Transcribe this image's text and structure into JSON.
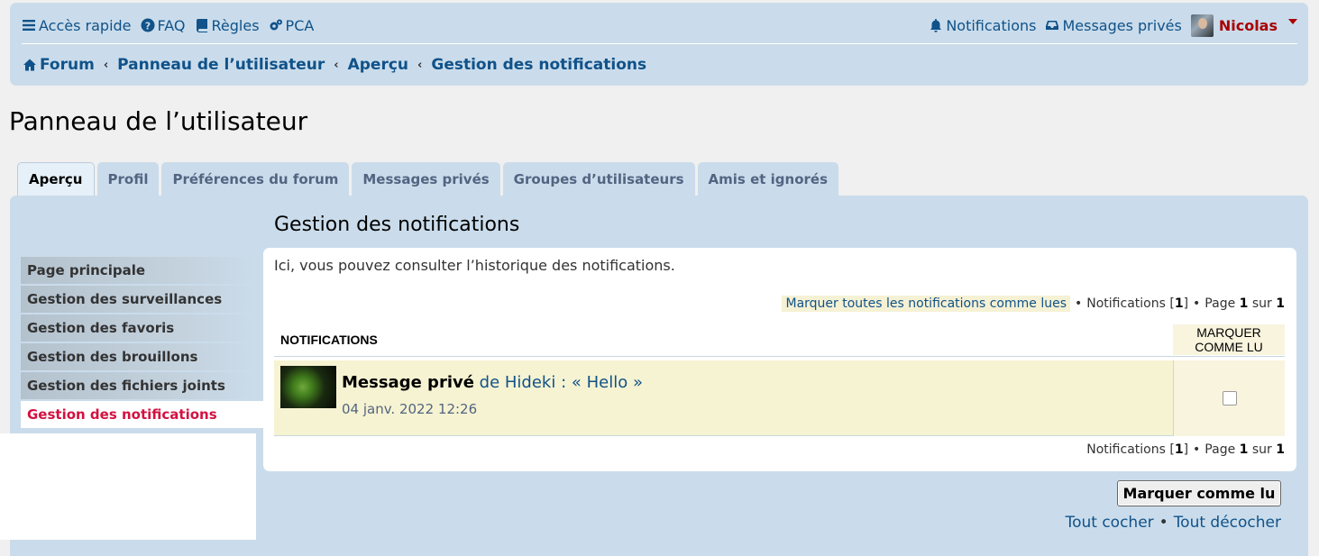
{
  "topnav": {
    "quick_access": "Accès rapide",
    "faq": "FAQ",
    "rules": "Règles",
    "ucp": "PCA",
    "notifications": "Notifications",
    "private_messages": "Messages privés",
    "username": "Nicolas"
  },
  "breadcrumbs": {
    "items": [
      "Forum",
      "Panneau de l’utilisateur",
      "Aperçu",
      "Gestion des notifications"
    ]
  },
  "page_title": "Panneau de l’utilisateur",
  "tabs": [
    "Aperçu",
    "Profil",
    "Préférences du forum",
    "Messages privés",
    "Groupes d’utilisateurs",
    "Amis et ignorés"
  ],
  "panel_heading": "Gestion des notifications",
  "sidebar": {
    "items": [
      "Page principale",
      "Gestion des surveillances",
      "Gestion des favoris",
      "Gestion des brouillons",
      "Gestion des fichiers joints",
      "Gestion des notifications"
    ]
  },
  "content": {
    "intro": "Ici, vous pouvez consulter l’historique des notifications.",
    "mark_all": "Marquer toutes les notifications comme lues",
    "bullet": "•",
    "notif_count_label": "Notifications",
    "notif_count_open": "[",
    "notif_count": "1",
    "notif_count_close": "]",
    "page_label": "Page",
    "page_current": "1",
    "page_of": "sur",
    "page_total": "1",
    "col_notifications": "NOTIFICATIONS",
    "col_mark_line1": "MARQUER",
    "col_mark_line2": "COMME LU"
  },
  "notification": {
    "type": "Message privé",
    "from": "de Hideki :",
    "subject": "« Hello »",
    "time": "04 janv. 2022 12:26"
  },
  "actions": {
    "mark_read_button": "Marquer comme lu",
    "check_all": "Tout cocher",
    "uncheck_all": "Tout décocher"
  },
  "colors": {
    "accent": "#105289",
    "username": "#aa0000",
    "active_sidebar": "#d31141",
    "panel_bg": "#cadceb"
  }
}
